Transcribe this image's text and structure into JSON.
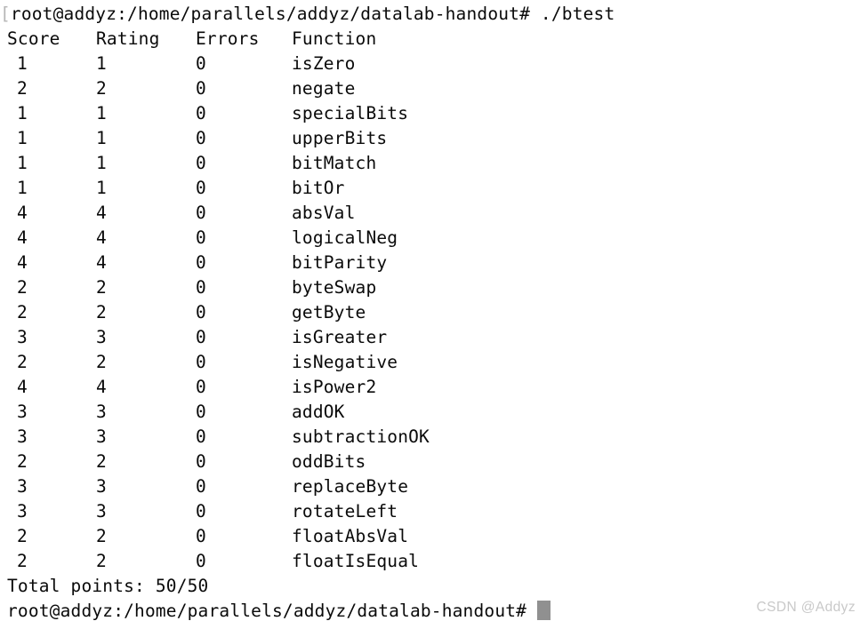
{
  "terminal": {
    "background_color": "#ffffff",
    "foreground_color": "#0a0a0a",
    "cursor_color": "#909090",
    "command_line": {
      "leading_artifact": "[",
      "prompt": "root@addyz:/home/parallels/addyz/datalab-handout#",
      "command": " ./btest"
    },
    "table": {
      "headers": {
        "score": "Score",
        "rating": "Rating",
        "errors": "Errors",
        "function": "Function"
      },
      "rows": [
        {
          "score": "1",
          "rating": "1",
          "errors": "0",
          "function": "isZero"
        },
        {
          "score": "2",
          "rating": "2",
          "errors": "0",
          "function": "negate"
        },
        {
          "score": "1",
          "rating": "1",
          "errors": "0",
          "function": "specialBits"
        },
        {
          "score": "1",
          "rating": "1",
          "errors": "0",
          "function": "upperBits"
        },
        {
          "score": "1",
          "rating": "1",
          "errors": "0",
          "function": "bitMatch"
        },
        {
          "score": "1",
          "rating": "1",
          "errors": "0",
          "function": "bitOr"
        },
        {
          "score": "4",
          "rating": "4",
          "errors": "0",
          "function": "absVal"
        },
        {
          "score": "4",
          "rating": "4",
          "errors": "0",
          "function": "logicalNeg"
        },
        {
          "score": "4",
          "rating": "4",
          "errors": "0",
          "function": "bitParity"
        },
        {
          "score": "2",
          "rating": "2",
          "errors": "0",
          "function": "byteSwap"
        },
        {
          "score": "2",
          "rating": "2",
          "errors": "0",
          "function": "getByte"
        },
        {
          "score": "3",
          "rating": "3",
          "errors": "0",
          "function": "isGreater"
        },
        {
          "score": "2",
          "rating": "2",
          "errors": "0",
          "function": "isNegative"
        },
        {
          "score": "4",
          "rating": "4",
          "errors": "0",
          "function": "isPower2"
        },
        {
          "score": "3",
          "rating": "3",
          "errors": "0",
          "function": "addOK"
        },
        {
          "score": "3",
          "rating": "3",
          "errors": "0",
          "function": "subtractionOK"
        },
        {
          "score": "2",
          "rating": "2",
          "errors": "0",
          "function": "oddBits"
        },
        {
          "score": "3",
          "rating": "3",
          "errors": "0",
          "function": "replaceByte"
        },
        {
          "score": "3",
          "rating": "3",
          "errors": "0",
          "function": "rotateLeft"
        },
        {
          "score": "2",
          "rating": "2",
          "errors": "0",
          "function": "floatAbsVal"
        },
        {
          "score": "2",
          "rating": "2",
          "errors": "0",
          "function": "floatIsEqual"
        }
      ]
    },
    "total_line": "Total points: 50/50",
    "final_prompt": "root@addyz:/home/parallels/addyz/datalab-handout#"
  },
  "watermark": {
    "text": "CSDN @Addyz",
    "color": "#c9c9c9"
  }
}
